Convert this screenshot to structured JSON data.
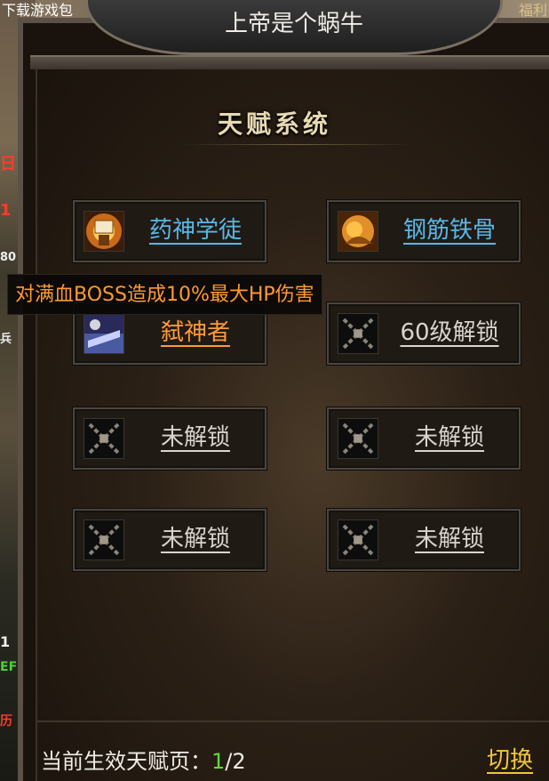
{
  "window": {
    "title": "上帝是个蜗牛"
  },
  "panel": {
    "title": "天赋系统"
  },
  "background_hud": {
    "top_left_text": "下载游戏包",
    "top_right_text": "福利",
    "left_fragments": [
      "日",
      "1",
      "80",
      "兵",
      "1",
      "EF",
      "历"
    ]
  },
  "talents": [
    {
      "label": "药神学徒",
      "state": "unlocked",
      "color": "#58b8e8",
      "icon": "medicine-scroll-icon"
    },
    {
      "label": "钢筋铁骨",
      "state": "unlocked",
      "color": "#58b8e8",
      "icon": "iron-body-icon"
    },
    {
      "label": "弑神者",
      "state": "unlocked",
      "color": "#ff9a3a",
      "icon": "god-slayer-icon"
    },
    {
      "label": "60级解锁",
      "state": "locked",
      "color": "#d8d4ce",
      "icon": "chain-lock-icon"
    },
    {
      "label": "未解锁",
      "state": "locked",
      "color": "#d8d4ce",
      "icon": "chain-lock-icon"
    },
    {
      "label": "未解锁",
      "state": "locked",
      "color": "#d8d4ce",
      "icon": "chain-lock-icon"
    },
    {
      "label": "未解锁",
      "state": "locked",
      "color": "#d8d4ce",
      "icon": "chain-lock-icon"
    },
    {
      "label": "未解锁",
      "state": "locked",
      "color": "#d8d4ce",
      "icon": "chain-lock-icon"
    }
  ],
  "tooltip": {
    "text": "对满血BOSS造成10%最大HP伤害"
  },
  "footer": {
    "label": "当前生效天赋页：",
    "current_page": "1",
    "total_pages": "/2",
    "switch_label": "切换"
  }
}
